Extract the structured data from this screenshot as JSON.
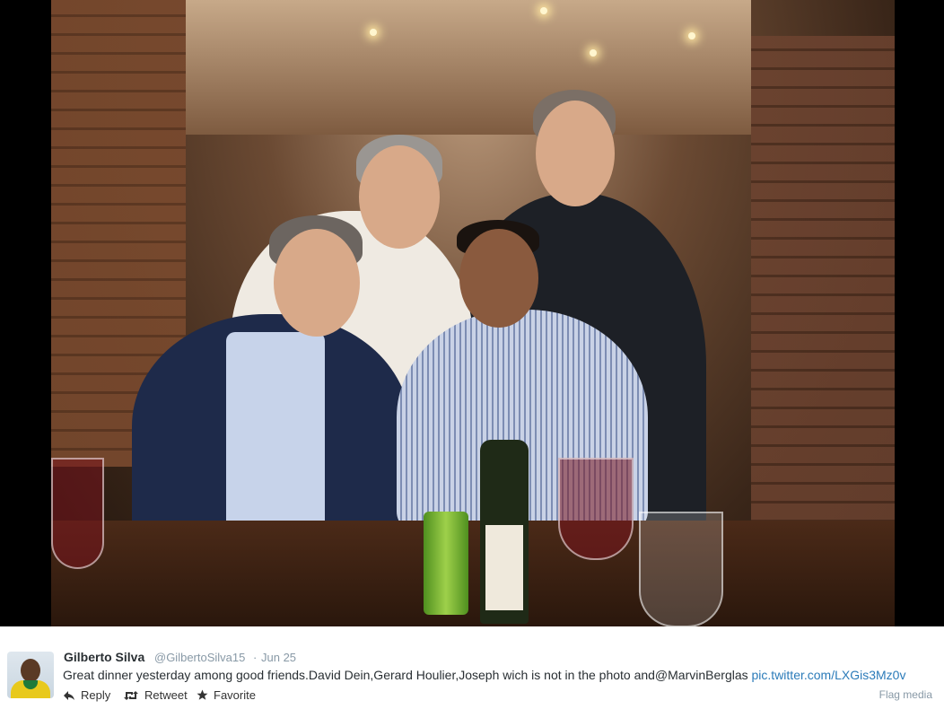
{
  "tweet": {
    "author_name": "Gilberto Silva",
    "author_handle": "@GilbertoSilva15",
    "separator": "·",
    "date": "Jun 25",
    "text": "Great dinner yesterday among good friends.David Dein,Gerard Houlier,Joseph wich is not in the photo and@MarvinBerglas ",
    "link_text": "pic.twitter.com/LXGis3Mz0v"
  },
  "actions": {
    "reply_label": "Reply",
    "retweet_label": "Retweet",
    "favorite_label": "Favorite",
    "flag_label": "Flag media"
  },
  "colors": {
    "link": "#2b7bb9",
    "muted": "#8899a6",
    "text": "#292f33"
  },
  "icons": {
    "reply": "reply-icon",
    "retweet": "retweet-icon",
    "favorite": "star-icon"
  }
}
